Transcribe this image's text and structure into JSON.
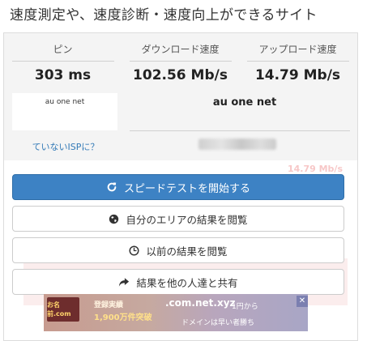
{
  "headline": "速度測定や、速度診断・速度向上ができるサイト",
  "stats": {
    "ping_label": "ピン",
    "ping_value": "303 ms",
    "download_label": "ダウンロード速度",
    "download_value": "102.56 Mb/s",
    "upload_label": "アップロード速度",
    "upload_value": "14.79 Mb/s"
  },
  "isp": {
    "logo_text": "au one net",
    "name": "au one net",
    "wrong_isp_link": "ていないISPに？",
    "ghost_value": "14.79 Mb/s"
  },
  "buttons": {
    "start_test": "スピードテストを開始する",
    "area_results": "自分のエリアの結果を閲覧",
    "past_results": "以前の結果を閲覧",
    "share_results": "結果を他の人達と共有"
  },
  "ad": {
    "logo": "お名前.com",
    "line1": "登録実績",
    "line2": "1,900万件突破",
    "line3": ".com.net.xyz",
    "line4": "1円から",
    "line5": "ドメインは早い者勝ち",
    "close": "✕"
  },
  "colors": {
    "primary_button": "#3d82c4",
    "link": "#337ab7",
    "stats_background": "#f4f4f4"
  }
}
